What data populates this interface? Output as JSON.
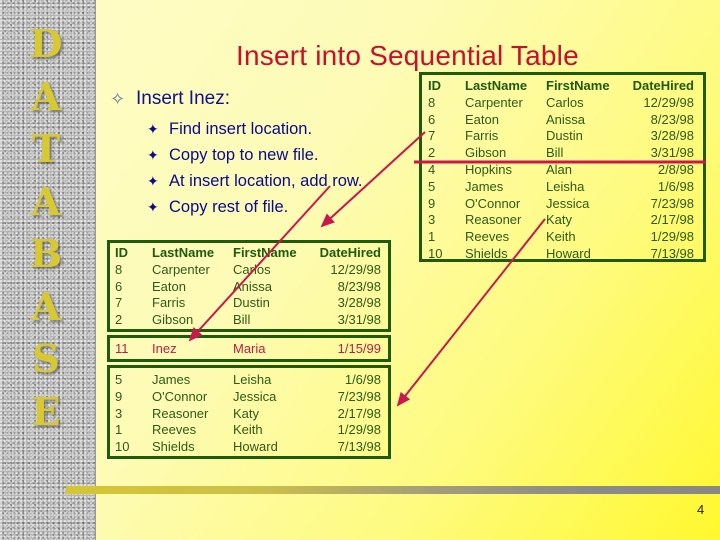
{
  "sidebar": {
    "letters": [
      "D",
      "A",
      "T",
      "A",
      "B",
      "A",
      "S",
      "E"
    ]
  },
  "title": "Insert into Sequential Table",
  "bullets": {
    "main": {
      "icon": "hollow-four-point-star-icon",
      "text": "Insert Inez:"
    },
    "sub": [
      {
        "icon": "four-point-star-icon",
        "text": "Find insert location."
      },
      {
        "icon": "four-point-star-icon",
        "text": "Copy top to new file."
      },
      {
        "icon": "four-point-star-icon",
        "text": "At insert location, add row."
      },
      {
        "icon": "four-point-star-icon",
        "text": "Copy rest of file."
      }
    ]
  },
  "columns": [
    "ID",
    "LastName",
    "FirstName",
    "DateHired"
  ],
  "original_table": {
    "rows": [
      [
        "8",
        "Carpenter",
        "Carlos",
        "12/29/98"
      ],
      [
        "6",
        "Eaton",
        "Anissa",
        "8/23/98"
      ],
      [
        "7",
        "Farris",
        "Dustin",
        "3/28/98"
      ],
      [
        "2",
        "Gibson",
        "Bill",
        "3/31/98"
      ],
      [
        "4",
        "Hopkins",
        "Alan",
        "2/8/98"
      ],
      [
        "5",
        "James",
        "Leisha",
        "1/6/98"
      ],
      [
        "9",
        "O'Connor",
        "Jessica",
        "7/23/98"
      ],
      [
        "3",
        "Reasoner",
        "Katy",
        "2/17/98"
      ],
      [
        "1",
        "Reeves",
        "Keith",
        "1/29/98"
      ],
      [
        "10",
        "Shields",
        "Howard",
        "7/13/98"
      ]
    ]
  },
  "new_file": {
    "top_rows": [
      [
        "8",
        "Carpenter",
        "Carlos",
        "12/29/98"
      ],
      [
        "6",
        "Eaton",
        "Anissa",
        "8/23/98"
      ],
      [
        "7",
        "Farris",
        "Dustin",
        "3/28/98"
      ],
      [
        "2",
        "Gibson",
        "Bill",
        "3/31/98"
      ]
    ],
    "inserted_row": [
      "11",
      "Inez",
      "Maria",
      "1/15/99"
    ],
    "rest_rows": [
      [
        "5",
        "James",
        "Leisha",
        "1/6/98"
      ],
      [
        "9",
        "O'Connor",
        "Jessica",
        "7/23/98"
      ],
      [
        "3",
        "Reasoner",
        "Katy",
        "2/17/98"
      ],
      [
        "1",
        "Reeves",
        "Keith",
        "1/29/98"
      ],
      [
        "10",
        "Shields",
        "Howard",
        "7/13/98"
      ]
    ]
  },
  "colors": {
    "title": "#c8102e",
    "bullet_text": "#0a0a8c",
    "table_border": "#1f5a0e",
    "table_text": "#2e5a1a",
    "inserted_row": "#b8204a",
    "arrows": "#c8184e",
    "sidebar_letters": "#d8c832"
  },
  "page_number": "4"
}
